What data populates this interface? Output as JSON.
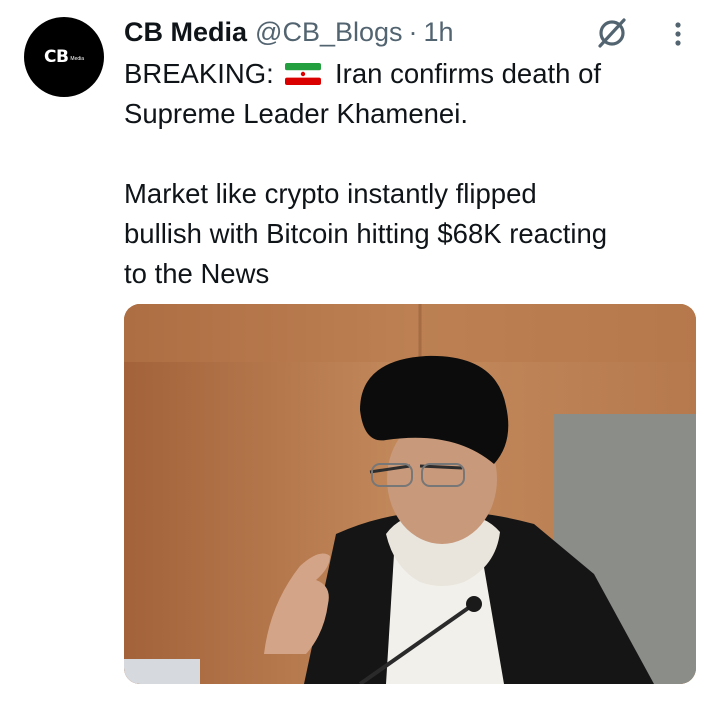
{
  "tweet": {
    "author": {
      "name": "CB Media",
      "handle": "@CB_Blogs",
      "avatar_text": "CB",
      "avatar_subtext": "Media"
    },
    "separator": "·",
    "time": "1h",
    "text_prefix": "BREAKING: ",
    "flag_icon": "iran-flag-emoji",
    "text_line1_rest": " Iran confirms death of",
    "text_line2": "Supreme Leader Khamenei.",
    "paragraph2": "Market like crypto instantly flipped\nbullish with Bitcoin hitting $68K reacting\nto the News",
    "icons": {
      "grok": "grok-icon",
      "more": "more-vertical-icon"
    }
  },
  "colors": {
    "text": "#0f1419",
    "secondary": "#536471",
    "background": "#ffffff"
  }
}
